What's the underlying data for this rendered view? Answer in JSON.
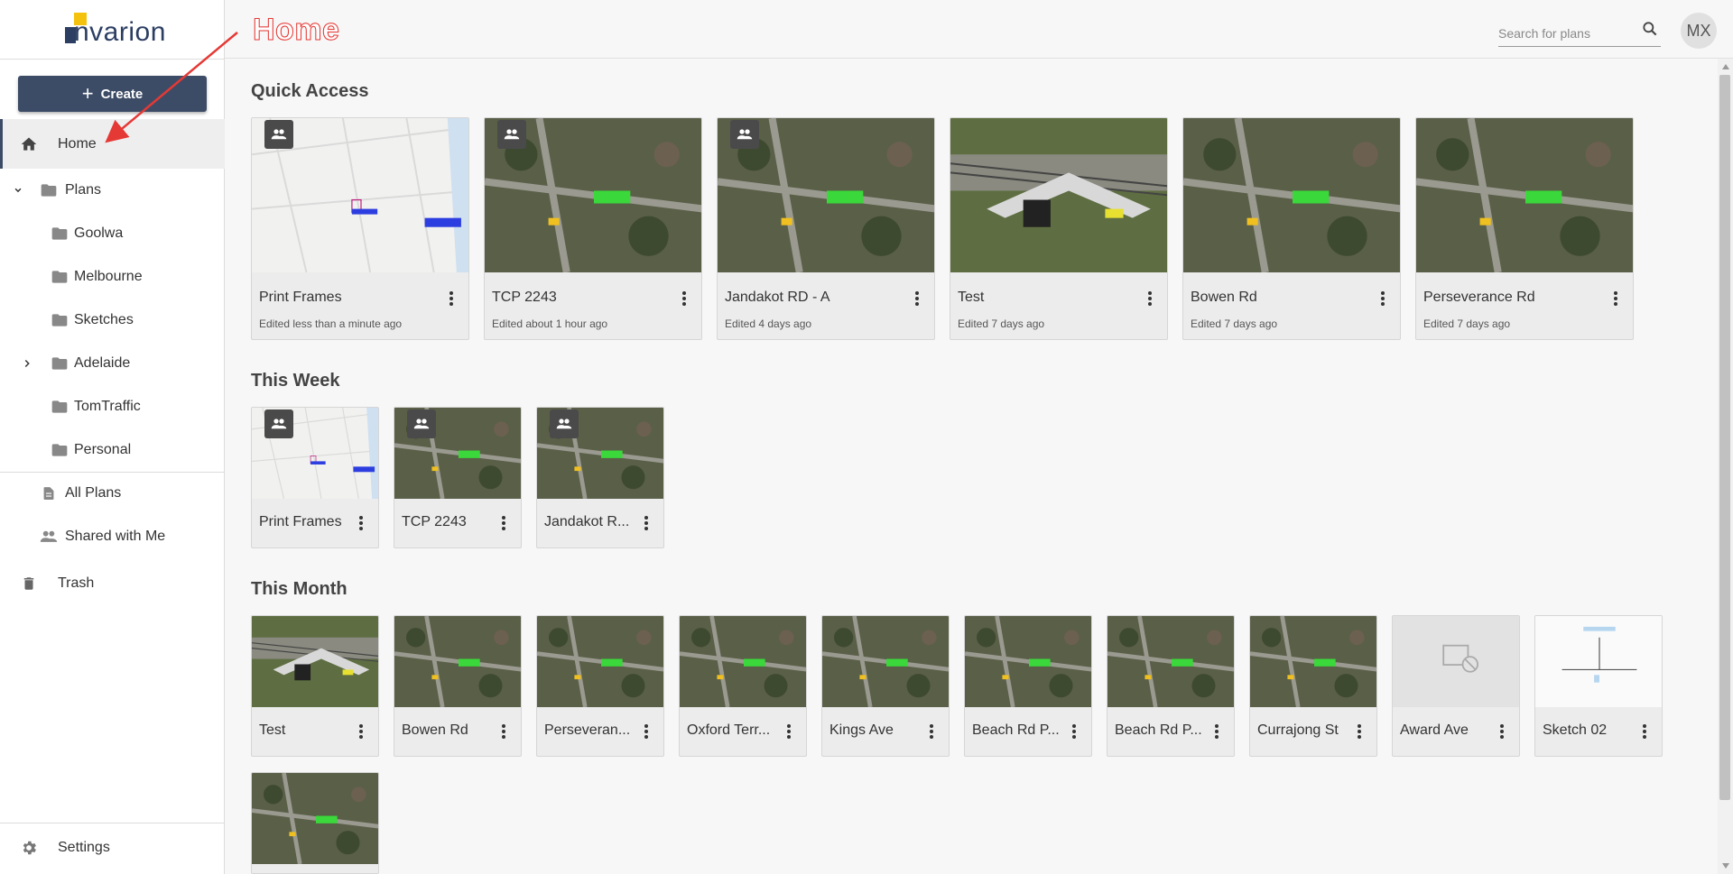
{
  "brand": {
    "name": "nvarion",
    "accent": "#3d4c66",
    "annotation_color": "#e53935"
  },
  "annotation": {
    "label": "Home"
  },
  "sidebar": {
    "create_label": "Create",
    "home": "Home",
    "plans": "Plans",
    "folders": [
      "Goolwa",
      "Melbourne",
      "Sketches",
      "Adelaide",
      "TomTraffic",
      "Personal"
    ],
    "all_plans": "All Plans",
    "shared": "Shared with Me",
    "trash": "Trash",
    "settings": "Settings"
  },
  "header": {
    "search_placeholder": "Search for plans",
    "avatar_initials": "MX"
  },
  "sections": {
    "quick_access": {
      "title": "Quick Access",
      "cards": [
        {
          "name": "Print Frames",
          "subtitle": "Edited less than a minute ago",
          "shared": true,
          "thumb": "map"
        },
        {
          "name": "TCP 2243",
          "subtitle": "Edited about 1 hour ago",
          "shared": true,
          "thumb": "sat"
        },
        {
          "name": "Jandakot RD - A",
          "subtitle": "Edited 4 days ago",
          "shared": true,
          "thumb": "sat"
        },
        {
          "name": "Test",
          "subtitle": "Edited 7 days ago",
          "shared": false,
          "thumb": "rail"
        },
        {
          "name": "Bowen Rd",
          "subtitle": "Edited 7 days ago",
          "shared": false,
          "thumb": "sat"
        },
        {
          "name": "Perseverance Rd",
          "subtitle": "Edited 7 days ago",
          "shared": false,
          "thumb": "sat"
        }
      ]
    },
    "this_week": {
      "title": "This Week",
      "cards": [
        {
          "name": "Print Frames",
          "shared": true,
          "thumb": "map"
        },
        {
          "name": "TCP 2243",
          "shared": true,
          "thumb": "sat"
        },
        {
          "name": "Jandakot R...",
          "shared": true,
          "thumb": "sat"
        }
      ]
    },
    "this_month": {
      "title": "This Month",
      "cards": [
        {
          "name": "Test",
          "thumb": "rail"
        },
        {
          "name": "Bowen Rd",
          "thumb": "sat"
        },
        {
          "name": "Perseveran...",
          "thumb": "sat"
        },
        {
          "name": "Oxford Terr...",
          "thumb": "sat"
        },
        {
          "name": "Kings Ave",
          "thumb": "sat"
        },
        {
          "name": "Beach Rd P...",
          "thumb": "sat"
        },
        {
          "name": "Beach Rd P...",
          "thumb": "sat"
        },
        {
          "name": "Currajong St",
          "thumb": "sat"
        },
        {
          "name": "Award Ave",
          "thumb": "placeholder"
        },
        {
          "name": "Sketch 02",
          "thumb": "sketch"
        },
        {
          "name": "",
          "thumb": "sat"
        }
      ]
    }
  }
}
